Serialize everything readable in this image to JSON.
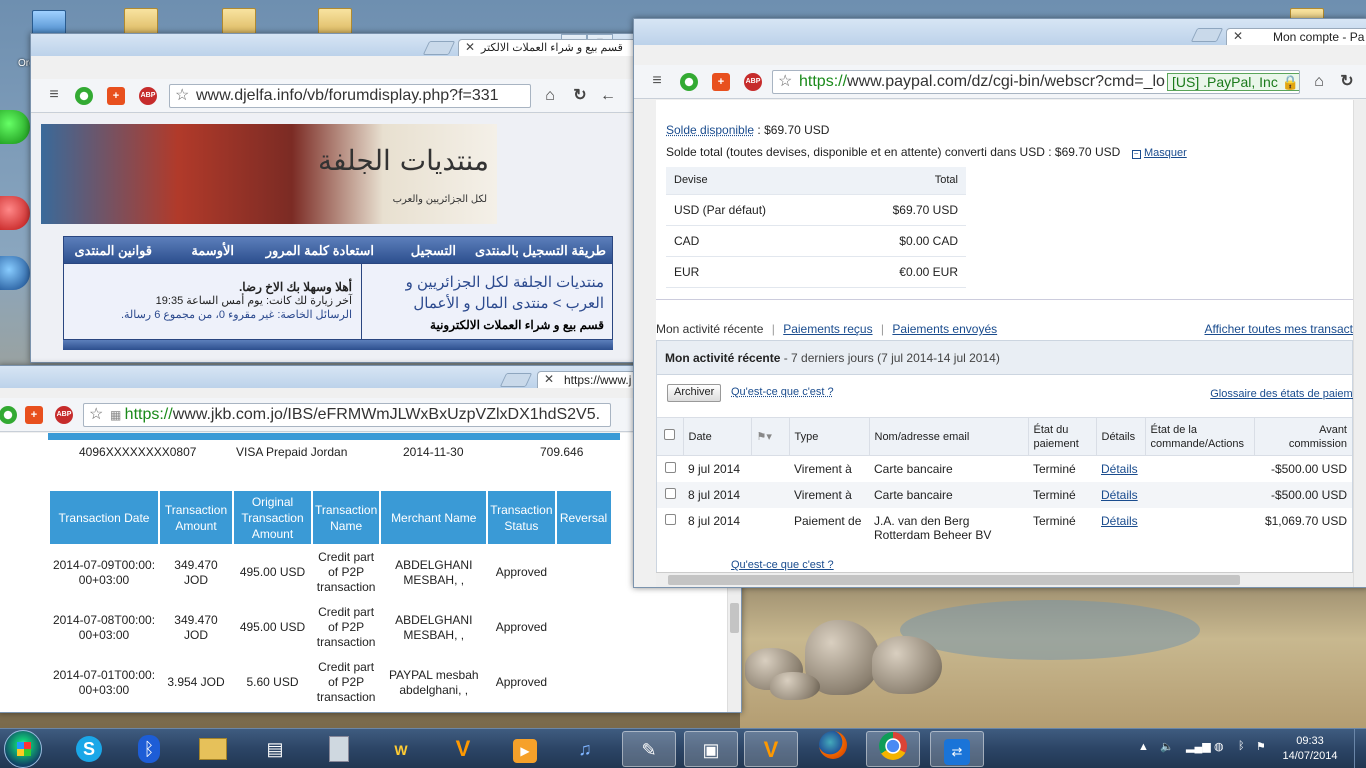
{
  "desktop": {
    "icons": [
      {
        "label": "Ordinateur",
        "kind": "pc"
      },
      {
        "label": "",
        "kind": "folder"
      },
      {
        "label": "",
        "kind": "folder"
      },
      {
        "label": "",
        "kind": "folder"
      }
    ]
  },
  "djelfa": {
    "tab_title": "قسم بيع و شراء العملات الالكتر",
    "url": "www.djelfa.info/vb/forumdisplay.php?f=331",
    "logo": "منتديات الجلفة",
    "logo_sub": "لكل الجزائريين والعرب",
    "nav": [
      "طريقة التسجيل بالمنتدى",
      "التسجيل",
      "استعادة كلمة المرور",
      "الأوسمة",
      "قوانين المنتدى"
    ],
    "breadcrumb_line1": "منتديات الجلفة لكل الجزائريين و",
    "breadcrumb_line2": "العرب > منتدى المال و الأعمال",
    "breadcrumb_current": "قسم بيع و شراء العملات الالكترونية",
    "welcome": "أهلا وسهلا بك الاخ رضا.",
    "last_visit": "آخر زيارة لك كانت: يوم أمس الساعة 19:35",
    "private_messages": "الرسائل الخاصة: غير مقروء 0، من مجموع 6 رسالة."
  },
  "jkb": {
    "tab_title": "https://www.j",
    "url_prefix": "https://",
    "url_rest": "www.jkb.com.jo/IBS/eFRMWmJLWxBxUzpVZlxDX1hdS2V5.",
    "card": {
      "number": "4096XXXXXXXX0807",
      "type": "VISA Prepaid Jordan",
      "date": "2014-11-30",
      "balance": "709.646"
    },
    "columns": [
      "Transaction Date",
      "Transaction Amount",
      "Original Transaction Amount",
      "Transaction Name",
      "Merchant Name",
      "Transaction Status",
      "Reversal"
    ],
    "rows": [
      {
        "date": "2014-07-09T00:00:00+03:00",
        "amount": "349.470 JOD",
        "original": "495.00 USD",
        "name": "Credit part of P2P transaction",
        "merchant": "ABDELGHANI MESBAH, ,",
        "status": "Approved",
        "reversal": ""
      },
      {
        "date": "2014-07-08T00:00:00+03:00",
        "amount": "349.470 JOD",
        "original": "495.00 USD",
        "name": "Credit part of P2P transaction",
        "merchant": "ABDELGHANI MESBAH, ,",
        "status": "Approved",
        "reversal": ""
      },
      {
        "date": "2014-07-01T00:00:00+03:00",
        "amount": "3.954 JOD",
        "original": "5.60 USD",
        "name": "Credit part of P2P transaction",
        "merchant": "PAYPAL mesbah abdelghani, ,",
        "status": "Approved",
        "reversal": ""
      }
    ]
  },
  "paypal": {
    "tab_title": "Mon compte - Pa",
    "url_prefix": "https://",
    "url_rest": "www.paypal.com/dz/cgi-bin/webscr?cmd=_lo",
    "ev_badge": "[US] .PayPal, Inc",
    "solde_label": "Solde disponible",
    "solde_value": ": $69.70 USD",
    "total_label": "Solde total (toutes devises, disponible et en attente) converti dans USD :",
    "total_value": "$69.70 USD",
    "hide_link": "Masquer",
    "currency_headers": [
      "Devise",
      "Total"
    ],
    "currencies": [
      {
        "code": "USD (Par défaut)",
        "total": "$69.70 USD"
      },
      {
        "code": "CAD",
        "total": "$0.00 CAD"
      },
      {
        "code": "EUR",
        "total": "€0.00 EUR"
      }
    ],
    "tabs": [
      "Mon activité récente",
      "Paiements reçus",
      "Paiements envoyés"
    ],
    "all_link": "Afficher toutes mes transactions",
    "activity_title": "Mon activité récente",
    "activity_range": " - 7 derniers jours (7 jul 2014-14 jul 2014)",
    "archive_button": "Archiver",
    "whatis": "Qu'est-ce que c'est ?",
    "glossary": "Glossaire des états de paiement",
    "tx_headers": [
      "Date",
      "Type",
      "Nom/adresse email",
      "État du paiement",
      "Détails",
      "État de la commande/Actions",
      "Avant commission"
    ],
    "transactions": [
      {
        "date": "9 jul 2014",
        "type": "Virement à",
        "name": "Carte bancaire",
        "name2": "",
        "status": "Terminé",
        "details": "Détails",
        "amount": "-$500.00 USD"
      },
      {
        "date": "8 jul 2014",
        "type": "Virement à",
        "name": "Carte bancaire",
        "name2": "",
        "status": "Terminé",
        "details": "Détails",
        "amount": "-$500.00 USD"
      },
      {
        "date": "8 jul 2014",
        "type": "Paiement de",
        "name": "J.A. van den Berg",
        "name2": "Rotterdam Beheer BV",
        "status": "Terminé",
        "details": "Détails",
        "amount": "$1,069.70 USD"
      }
    ],
    "bottom_link": "Qu'est-ce que c'est ?"
  },
  "taskbar": {
    "clock_time": "09:33",
    "clock_date": "14/07/2014"
  }
}
